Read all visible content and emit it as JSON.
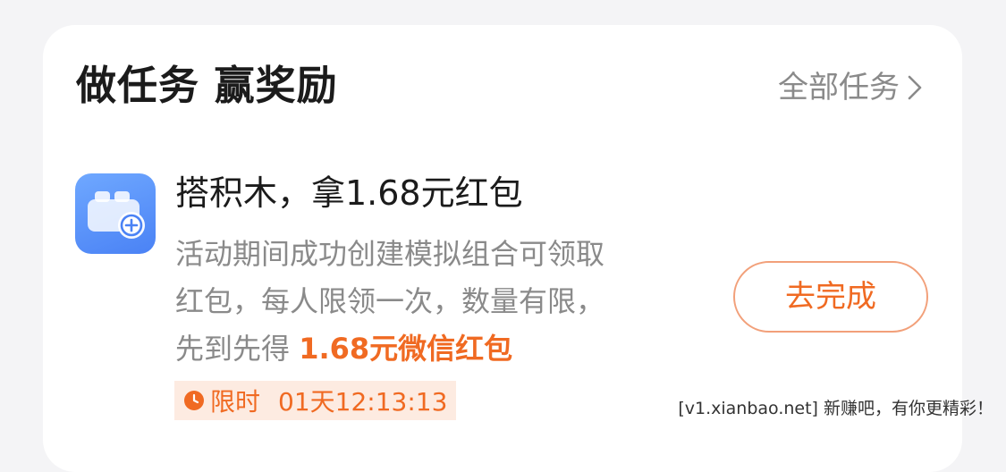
{
  "section": {
    "title": "做任务 赢奖励",
    "all_tasks_label": "全部任务"
  },
  "task": {
    "icon": "building-block-add-icon",
    "title": "搭积木，拿1.68元红包",
    "description": {
      "line1": "活动期间成功创建模拟组合可领取",
      "line2": "红包，每人限领一次，数量有限，",
      "line3_prefix": "先到先得",
      "reward": "1.68元微信红包"
    },
    "timer": {
      "label": "限时",
      "countdown": "01天12:13:13"
    },
    "button_label": "去完成"
  },
  "watermark": "[v1.xianbao.net] 新赚吧，有你更精彩！",
  "colors": {
    "accent": "#f06a22",
    "timer_bg": "#fdebe1",
    "icon_blue": "#5b92f8",
    "muted_text": "#8a8a8a",
    "title_text": "#1b1b1b"
  }
}
